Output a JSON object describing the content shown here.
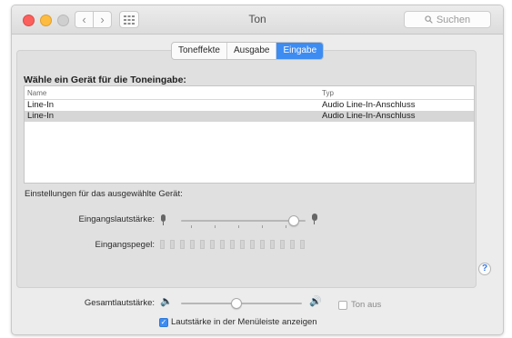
{
  "window": {
    "title": "Ton",
    "search_placeholder": "Suchen"
  },
  "toolbar": {
    "back_icon": "chevron-left-icon",
    "forward_icon": "chevron-right-icon",
    "grid_icon": "grid-icon"
  },
  "tabs": [
    {
      "label": "Toneffekte",
      "active": false
    },
    {
      "label": "Ausgabe",
      "active": false
    },
    {
      "label": "Eingabe",
      "active": true
    }
  ],
  "device_section": {
    "title": "Wähle ein Gerät für die Toneingabe:",
    "columns": [
      "Name",
      "Typ"
    ],
    "rows": [
      {
        "name": "Line-In",
        "type": "Audio Line-In-Anschluss",
        "selected": false
      },
      {
        "name": "Line-In",
        "type": "Audio Line-In-Anschluss",
        "selected": true
      }
    ]
  },
  "settings": {
    "label": "Einstellungen für das ausgewählte Gerät:",
    "input_volume_label": "Eingangslautstärke:",
    "input_volume_level": 0.9,
    "input_level_label": "Eingangspegel:",
    "input_level_segments": 15
  },
  "footer": {
    "output_volume_label": "Gesamtlautstärke:",
    "output_volume_level": 0.45,
    "mute_label": "Ton aus",
    "mute_checked": false,
    "show_in_menubar_label": "Lautstärke in der Menüleiste anzeigen",
    "show_in_menubar_checked": true
  },
  "colors": {
    "accent": "#3d8cf2",
    "close": "#fc605c",
    "minimize": "#fdbc40",
    "selected_row": "#d6d6d6"
  }
}
